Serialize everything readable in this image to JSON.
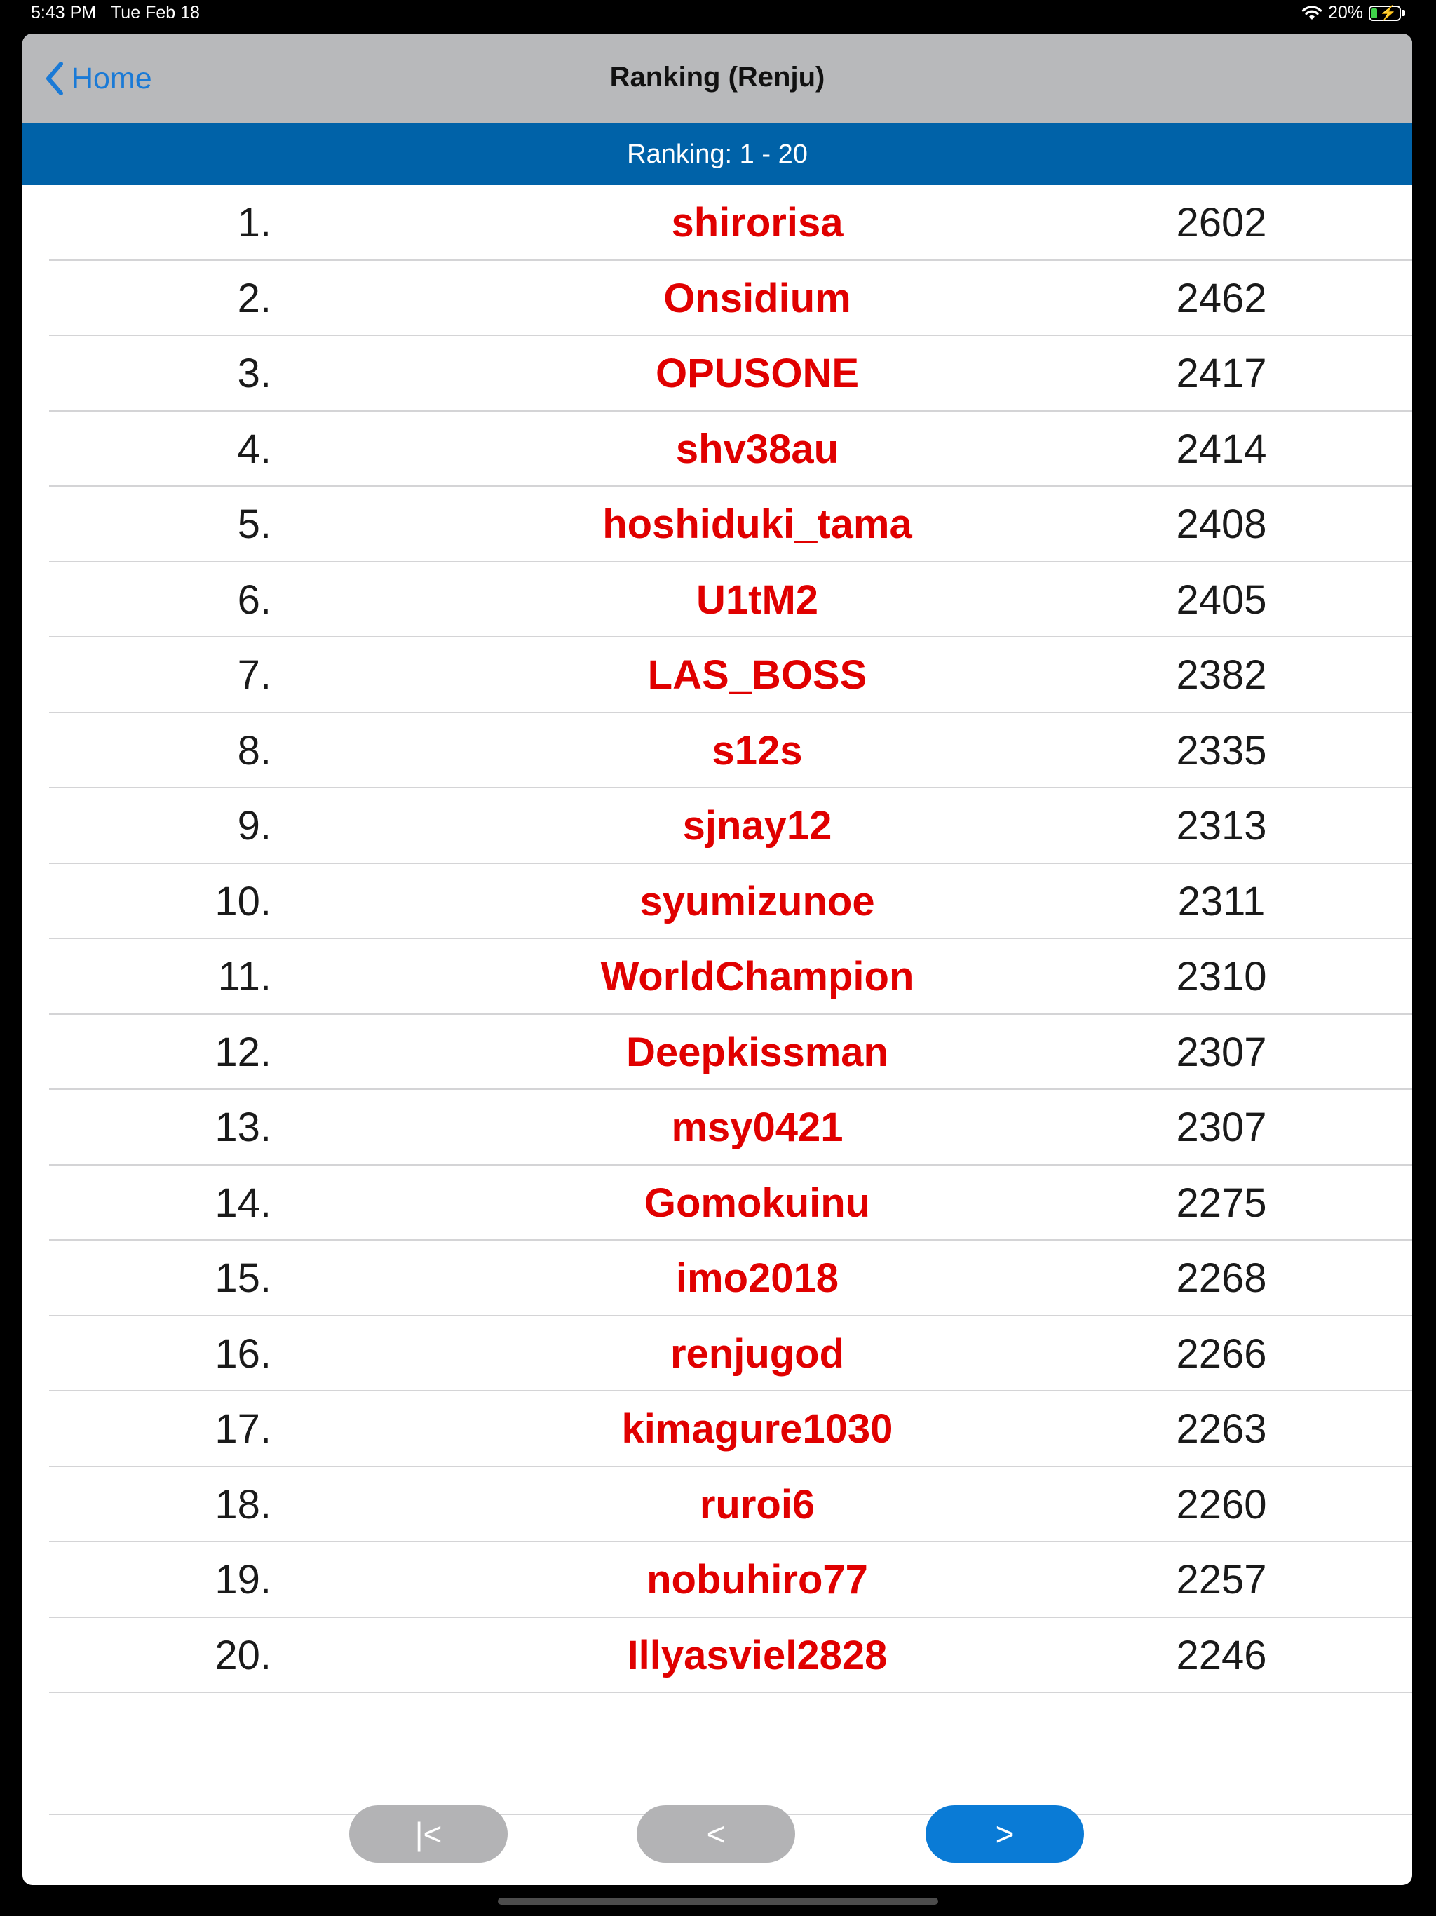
{
  "status_bar": {
    "time": "5:43 PM",
    "date": "Tue Feb 18",
    "battery_percent": "20%",
    "battery_level": 0.2,
    "battery_color": "#3fd34a"
  },
  "nav": {
    "back_label": "Home",
    "title": "Ranking (Renju)"
  },
  "range_label": "Ranking: 1 - 20",
  "rankings": [
    {
      "rank": "1.",
      "player": "shirorisa",
      "rating": "2602"
    },
    {
      "rank": "2.",
      "player": "Onsidium",
      "rating": "2462"
    },
    {
      "rank": "3.",
      "player": "OPUSONE",
      "rating": "2417"
    },
    {
      "rank": "4.",
      "player": "shv38au",
      "rating": "2414"
    },
    {
      "rank": "5.",
      "player": "hoshiduki_tama",
      "rating": "2408"
    },
    {
      "rank": "6.",
      "player": "U1tM2",
      "rating": "2405"
    },
    {
      "rank": "7.",
      "player": "LAS_BOSS",
      "rating": "2382"
    },
    {
      "rank": "8.",
      "player": "s12s",
      "rating": "2335"
    },
    {
      "rank": "9.",
      "player": "sjnay12",
      "rating": "2313"
    },
    {
      "rank": "10.",
      "player": "syumizunoe",
      "rating": "2311"
    },
    {
      "rank": "11.",
      "player": "WorldChampion",
      "rating": "2310"
    },
    {
      "rank": "12.",
      "player": "Deepkissman",
      "rating": "2307"
    },
    {
      "rank": "13.",
      "player": "msy0421",
      "rating": "2307"
    },
    {
      "rank": "14.",
      "player": "Gomokuinu",
      "rating": "2275"
    },
    {
      "rank": "15.",
      "player": "imo2018",
      "rating": "2268"
    },
    {
      "rank": "16.",
      "player": "renjugod",
      "rating": "2266"
    },
    {
      "rank": "17.",
      "player": "kimagure1030",
      "rating": "2263"
    },
    {
      "rank": "18.",
      "player": "ruroi6",
      "rating": "2260"
    },
    {
      "rank": "19.",
      "player": "nobuhiro77",
      "rating": "2257"
    },
    {
      "rank": "20.",
      "player": "Illyasviel2828",
      "rating": "2246"
    }
  ],
  "pager": {
    "first_label": "|<",
    "prev_label": "<",
    "next_label": ">"
  },
  "colors": {
    "accent": "#1a7ad6",
    "header_bar": "#0062a8",
    "player_name": "#e00000",
    "disabled_button": "#b3b3b5",
    "active_button": "#0a7bd6"
  }
}
